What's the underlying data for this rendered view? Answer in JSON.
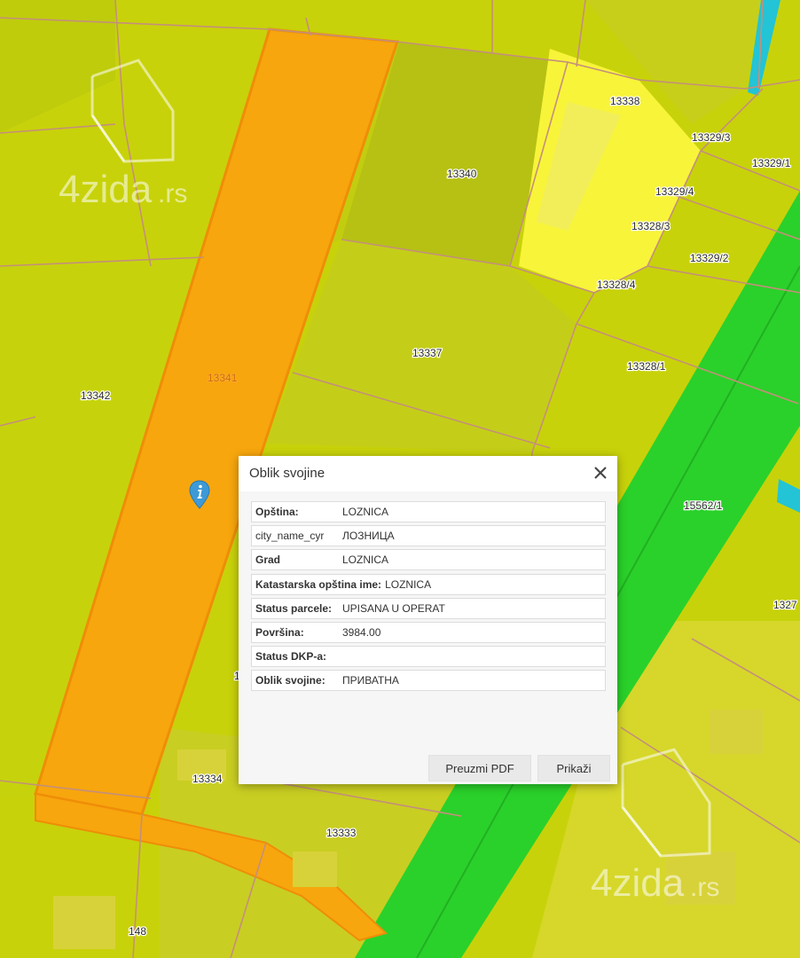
{
  "map": {
    "parcel_labels": {
      "p13338": "13338",
      "p13329_3": "13329/3",
      "p13329_1": "13329/1",
      "p13340": "13340",
      "p13329_4": "13329/4",
      "p13328_3": "13328/3",
      "p13329_2": "13329/2",
      "p13328_4": "13328/4",
      "p13337": "13337",
      "p13328_1": "13328/1",
      "p13341": "13341",
      "p13342": "13342",
      "p15562_1": "15562/1",
      "p1327x": "1327",
      "p1": "1",
      "p13334": "13334",
      "p13333": "13333",
      "p148": "148"
    },
    "watermark": {
      "brand_main": "4zida",
      "brand_tld": ".rs"
    },
    "colors": {
      "base": "#c8d20a",
      "selected_parcel": "#f7a60d",
      "road": "#2ad12a",
      "water": "#22c4d6",
      "highlight_parcel": "#ffff3a"
    },
    "marker_icon": "info-marker-icon"
  },
  "dialog": {
    "title": "Oblik svojine",
    "rows": [
      {
        "label": "Opština:",
        "value": "LOZNICA"
      },
      {
        "label": "city_name_cyr",
        "value": "ЛОЗНИЦА"
      },
      {
        "label": "Grad",
        "value": "LOZNICA"
      },
      {
        "label": "Katastarska opština ime:",
        "value": "LOZNICA"
      },
      {
        "label": "Status parcele:",
        "value": "UPISANA U OPERAT"
      },
      {
        "label": "Površina:",
        "value": "3984.00"
      },
      {
        "label": "Status DKP-a:",
        "value": ""
      },
      {
        "label": "Oblik svojine:",
        "value": "ПРИВАТНА"
      }
    ],
    "buttons": {
      "download_pdf": "Preuzmi PDF",
      "show": "Prikaži"
    }
  }
}
